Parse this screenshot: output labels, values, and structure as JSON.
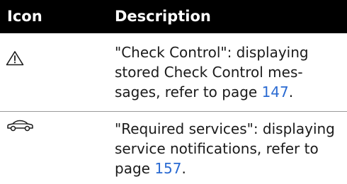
{
  "header": {
    "icon_label": "Icon",
    "description_label": "Description"
  },
  "rows": [
    {
      "icon": "warning-triangle-icon",
      "desc_line1": "\"Check Control\": displaying",
      "desc_line2": "stored Check Control mes-",
      "desc_prefix": "sages, refer to page ",
      "page": "147",
      "desc_suffix": "."
    },
    {
      "icon": "car-icon",
      "desc_line1": "\"Required services\": displaying",
      "desc_line2": "service notifications, refer to",
      "desc_prefix": "page ",
      "page": "157",
      "desc_suffix": "."
    }
  ],
  "colors": {
    "header_background": "#000000",
    "header_text": "#ffffff",
    "link": "#2a6ad2",
    "divider": "#9a9a9a"
  }
}
